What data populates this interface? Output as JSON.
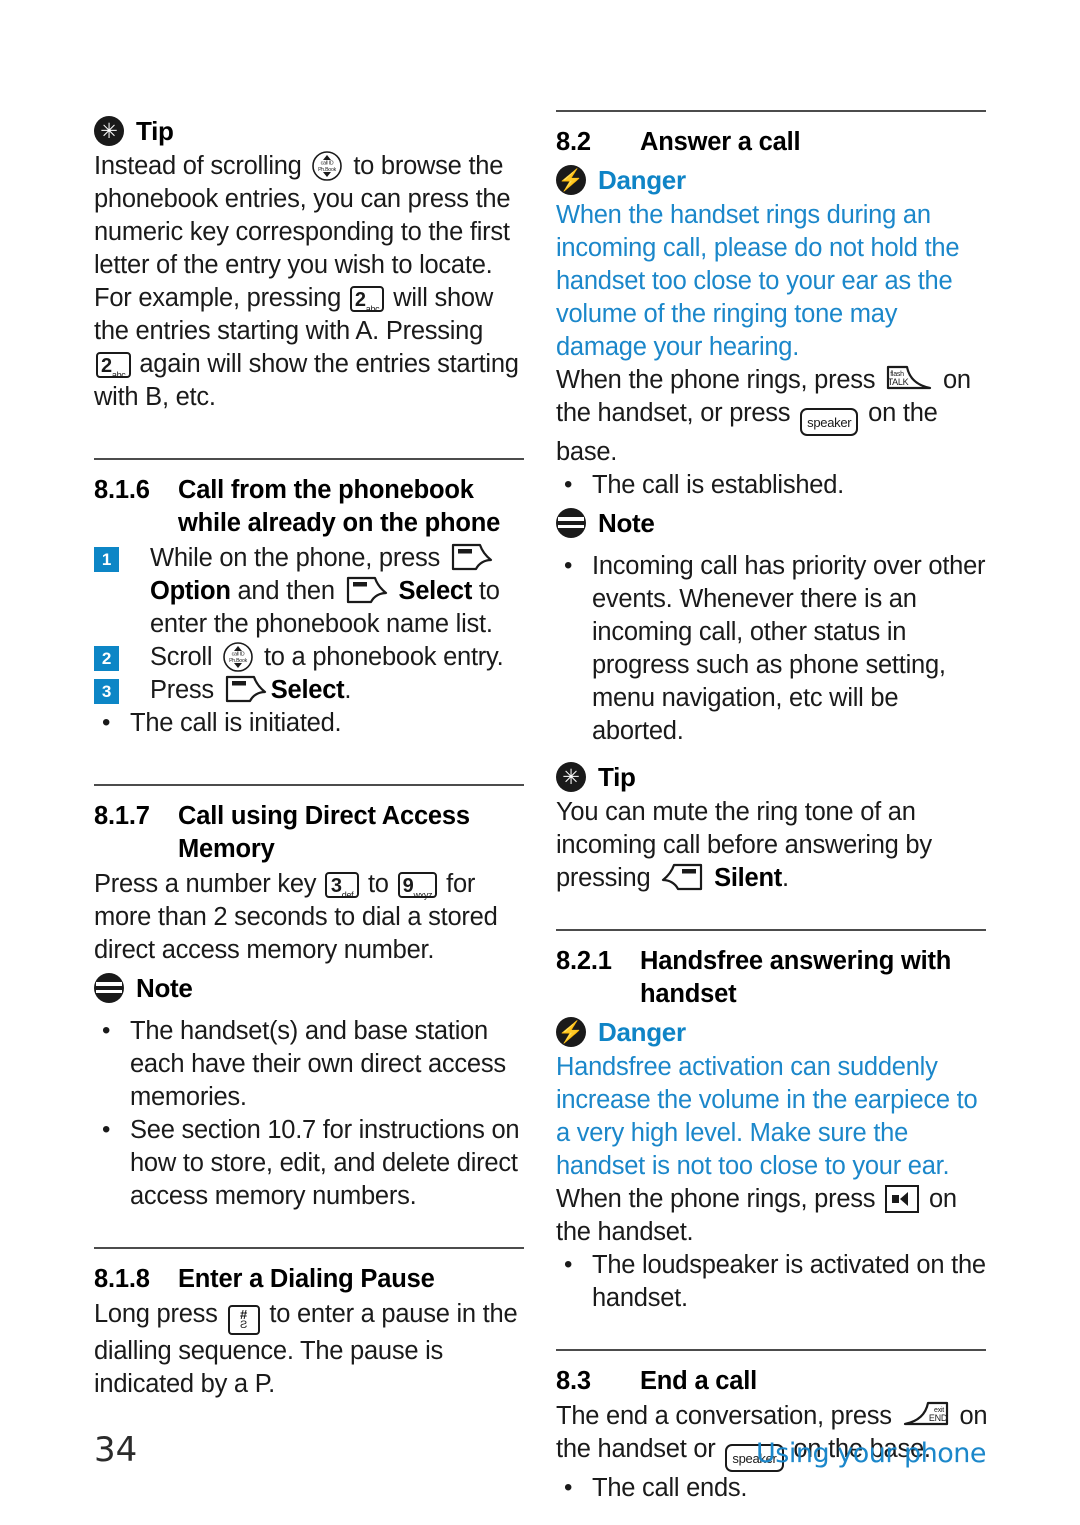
{
  "page": {
    "number": "34",
    "footer_right": "Using your phone",
    "accent_blue": "#1b87ca",
    "badge_blue": "#0d86c6"
  },
  "left_column": {
    "tip_1": {
      "icon": "tip-asterisk-icon",
      "label": "Tip",
      "text_1": "Instead of scrolling",
      "key_nav": {
        "top": "call ID",
        "bottom": "Ph.Book"
      },
      "text_2": "to browse the phonebook entries, you can press the numeric key corresponding to the first letter of the entry you wish to locate. For example, pressing",
      "key_2a": {
        "digit": "2",
        "letters": "abc"
      },
      "text_3": "will show the entries starting with A. Pressing",
      "key_2b": {
        "digit": "2",
        "letters": "abc"
      },
      "text_4": "again will show the entries starting with B, etc."
    },
    "section_816": {
      "number": "8.1.6",
      "title_line1": "Call from the phonebook",
      "title_line2": "while already on the phone",
      "steps": [
        {
          "num": "1",
          "text_1": "While on the phone, press",
          "softkey_1": "left-soft-key",
          "bold_1": "Option",
          "text_2": "and then",
          "softkey_2": "left-soft-key",
          "bold_2": "Select",
          "text_3": "to enter the phonebook name list."
        },
        {
          "num": "2",
          "text_1": "Scroll",
          "key_nav": {
            "top": "call ID",
            "bottom": "Ph.Book"
          },
          "text_2": "to a phonebook entry."
        },
        {
          "num": "3",
          "text_1": "Press",
          "softkey_1": "left-soft-key",
          "bold_1": "Select",
          "text_2": "."
        }
      ],
      "bullets": [
        "The call is initiated."
      ]
    },
    "section_817": {
      "number": "8.1.7",
      "title_line1": "Call using Direct Access",
      "title_line2": "Memory",
      "text_1": "Press a number key",
      "key_3": {
        "digit": "3",
        "letters": "def"
      },
      "text_2": "to",
      "key_9": {
        "digit": "9",
        "letters": "wxyz"
      },
      "text_3": "for more than 2 seconds to dial a stored direct access memory number.",
      "note": {
        "icon": "note-bars-icon",
        "label": "Note",
        "bullets": [
          "The handset(s) and base station each have their own direct access memories.",
          "See section 10.7 for instructions on how to store, edit, and delete direct access memory numbers."
        ]
      }
    },
    "section_818": {
      "number": "8.1.8",
      "title_line1": "Enter a Dialing Pause",
      "text_1": "Long press",
      "key_hash": {
        "top": "#",
        "bottom": "Ƨ"
      },
      "text_2": "to enter a pause in the dialling sequence. The pause is indicated by a P."
    }
  },
  "right_column": {
    "section_82": {
      "number": "8.2",
      "title_line1": "Answer a call",
      "danger": {
        "icon": "danger-bolt-icon",
        "label": "Danger",
        "text": "When the handset rings during an incoming call, please do not hold the handset too close to your ear as the volume of the ringing tone may damage your hearing."
      },
      "text_1": "When the phone rings, press",
      "key_talk": {
        "top": "flash",
        "bottom": "TALK"
      },
      "text_2": "on the handset, or press",
      "key_speaker": "speaker",
      "text_3": "on the base.",
      "bullets": [
        "The call is established."
      ],
      "note": {
        "icon": "note-bars-icon",
        "label": "Note",
        "bullets": [
          "Incoming call has priority over other events. Whenever there is an incoming call, other status in progress such as phone setting, menu navigation, etc will be aborted."
        ]
      },
      "tip": {
        "icon": "tip-asterisk-icon",
        "label": "Tip",
        "text_1": "You can mute the ring tone of an incoming call before answering by pressing",
        "softkey": "right-soft-key",
        "bold_1": "Silent",
        "text_2": "."
      }
    },
    "section_821": {
      "number": "8.2.1",
      "title_line1": "Handsfree answering with",
      "title_line2": "handset",
      "danger": {
        "icon": "danger-bolt-icon",
        "label": "Danger",
        "text": "Handsfree activation can suddenly increase the volume in the earpiece to a very high level. Make sure the handset is not too close to your ear."
      },
      "text_1": "When the phone rings, press",
      "key_loudspeaker": "loudspeaker-icon",
      "text_2": "on the handset.",
      "bullets": [
        "The loudspeaker is activated on the handset."
      ]
    },
    "section_83": {
      "number": "8.3",
      "title_line1": "End a call",
      "text_1": "The end a conversation, press",
      "key_end": {
        "top": "exit",
        "bottom": "END"
      },
      "text_2": "on the handset or",
      "key_speaker": "speaker",
      "text_3": "on the base.",
      "bullets": [
        "The call ends."
      ]
    }
  }
}
